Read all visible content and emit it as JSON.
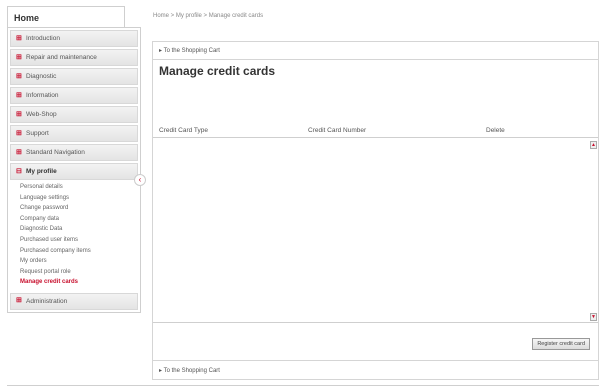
{
  "sidebar": {
    "home_label": "Home",
    "items_top": [
      {
        "label": "Introduction"
      },
      {
        "label": "Repair and maintenance"
      },
      {
        "label": "Diagnostic"
      },
      {
        "label": "Information"
      },
      {
        "label": "Web-Shop"
      },
      {
        "label": "Support"
      },
      {
        "label": "Standard Navigation"
      }
    ],
    "open_item": {
      "label": "My profile"
    },
    "sub_items": [
      {
        "label": "Personal details"
      },
      {
        "label": "Language settings"
      },
      {
        "label": "Change password"
      },
      {
        "label": "Company data"
      },
      {
        "label": "Diagnostic Data"
      },
      {
        "label": "Purchased user items"
      },
      {
        "label": "Purchased company items"
      },
      {
        "label": "My orders"
      },
      {
        "label": "Request portal role"
      },
      {
        "label": "Manage credit cards"
      }
    ],
    "items_bottom": [
      {
        "label": "Administration"
      }
    ],
    "plus_glyph": "⊞",
    "minus_glyph": "⊟",
    "collapse_glyph": "‹"
  },
  "breadcrumb": {
    "home": "Home",
    "separator": " > ",
    "profile": "My profile",
    "current": "Manage credit cards"
  },
  "main": {
    "cart_link": "▸ To the Shopping Cart",
    "title": "Manage credit cards",
    "columns": [
      "Credit Card Type",
      "Credit Card Number",
      "Delete"
    ],
    "register_button": "Register credit card"
  },
  "colors": {
    "accent": "#c8102e"
  }
}
